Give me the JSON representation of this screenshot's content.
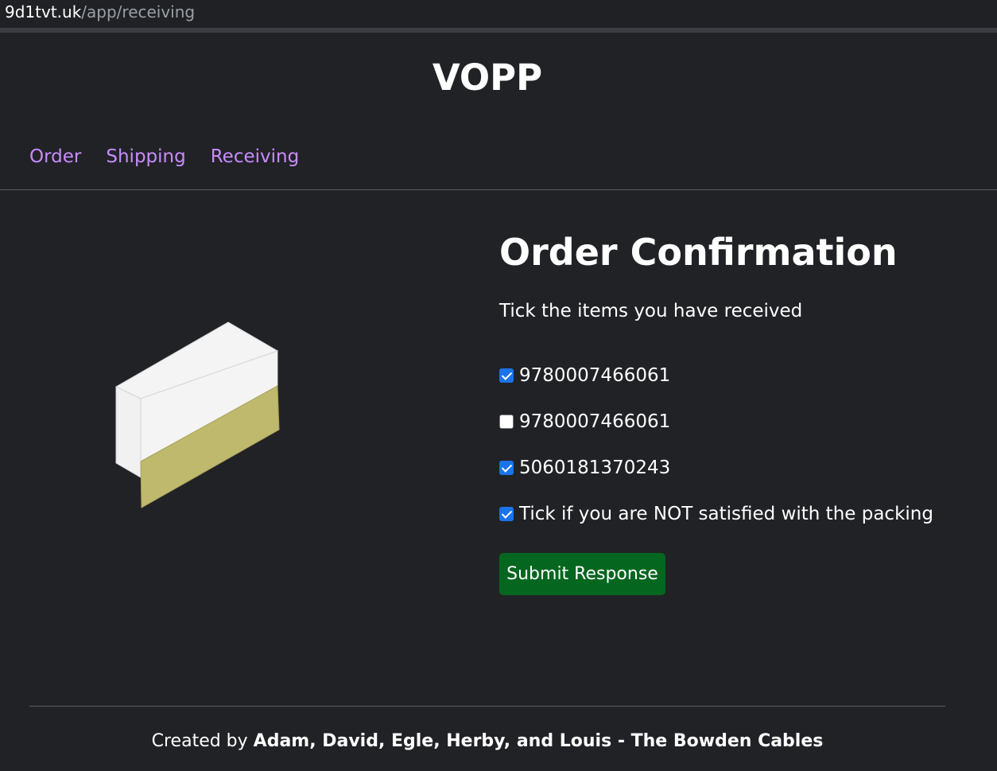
{
  "browser": {
    "url_host": "9d1tvt.uk",
    "url_path": "/app/receiving"
  },
  "site": {
    "title": "VOPP"
  },
  "nav": {
    "items": [
      {
        "label": "Order"
      },
      {
        "label": "Shipping"
      },
      {
        "label": "Receiving"
      }
    ],
    "link_color": "#c88cff"
  },
  "main": {
    "heading": "Order Confirmation",
    "instruction": "Tick the items you have received",
    "items": [
      {
        "label": "9780007466061",
        "checked": true
      },
      {
        "label": "9780007466061",
        "checked": false
      },
      {
        "label": "5060181370243",
        "checked": true
      }
    ],
    "packing_checkbox": {
      "label": "Tick if you are NOT satisfied with the packing",
      "checked": true
    },
    "submit_label": "Submit Response",
    "submit_color": "#04661f",
    "illustration_icon": "open-box-icon"
  },
  "footer": {
    "prefix": "Created by ",
    "authors": "Adam, David, Egle, Herby, and Louis - The Bowden Cables"
  }
}
